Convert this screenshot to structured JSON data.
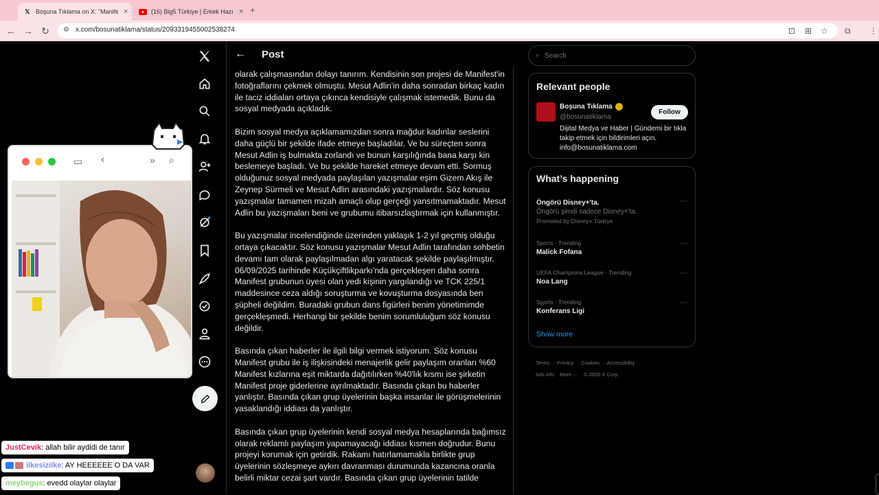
{
  "browser": {
    "tabs": [
      {
        "title": "Boşuna Tıklama on X: \"Manifest...",
        "favicon": "x-logo",
        "active": true
      },
      {
        "title": "(16) Big5 Türkiye | Erkek Hazırlık...",
        "favicon": "youtube-logo",
        "active": false
      }
    ],
    "new_tab": "+",
    "url": "x.com/bosunatiklama/status/2093319455002538274"
  },
  "nav": {
    "items": [
      "x-logo",
      "home-icon",
      "explore-icon",
      "notifications-icon",
      "follow-icon",
      "messages-icon",
      "grok-icon",
      "bookmarks-icon",
      "premium-icon",
      "verified-orgs-icon",
      "profile-icon",
      "more-icon"
    ],
    "compose": "compose-icon"
  },
  "post": {
    "header_title": "Post",
    "paragraphs": [
      "olarak çalışmasından dolayı tanırım. Kendisinin son projesi de Manifest'in fotoğraflarını çekmek olmuştu. Mesut Adlin'in daha sonradan birkaç kadın ile taciz iddiaları ortaya çıkınca kendisiyle çalışmak istemedik. Bunu da sosyal medyada açıkladık.",
      "Bizim sosyal medya açıklamamızdan sonra mağdur kadınlar seslerini daha güçlü bir şekilde ifade etmeye başladılar. Ve bu süreçten sonra Mesut Adlin iş bulmakta zorlandı ve bunun karşılığında bana karşı kin beslemeye başladı. Ve bu şekilde hareket etmeye devam etti. Sormuş olduğunuz sosyal medyada paylaşılan yazışmalar eşim Gizem Akış ile Zeynep Sürmeli ve Mesut Adlin arasındaki yazışmalardır. Söz konusu yazışmalar tamamen mizah amaçlı olup gerçeği yansıtmamaktadır. Mesut Adlin bu yazışmaları beni ve grubumu itibarsızlaştırmak için kullanmıştır.",
      "Bu yazışmalar incelendiğinde üzerinden yaklaşık 1-2 yıl geçmiş olduğu ortaya çıkacaktır. Söz konusu yazışmalar Mesut Adlin tarafından sohbetin devamı tam olarak paylaşılmadan algı yaratacak şekilde paylaşılmıştır. 06/09/2025 tarihinde Küçükçiftlikparkı'nda gerçekleşen daha sonra Manifest grubunun üyesi olan yedi kişinin yargılandığı ve TCK 225/1 maddesince ceza aldığı soruşturma ve kovuşturma dosyasında ben şüpheli değildim. Buradaki grubun dans figürleri benim yönetimimde gerçekleşmedi. Herhangi bir şekilde benim sorumluluğum söz konusu değildir.",
      "Basında çıkan haberler ile ilgili bilgi vermek istiyorum. Söz konusu Manifest grubu ile iş ilişkisindeki menajerlik gelir paylaşım oranları %60 Manifest kızlarına eşit miktarda dağıtılırken %40'lık kısmı ise şirketin Manifest proje giderlerine ayrılmaktadır. Basında çıkan bu haberler yanlıştır. Basında çıkan grup üyelerinin başka insanlar ile görüşmelerinin yasaklandığı iddiası da yanlıştır.",
      "Basında çıkan grup üyelerinin kendi sosyal medya hesaplarında bağımsız olarak reklamlı paylaşım yapamayacağı iddiası kısmen doğrudur. Bunu projeyi korumak için getirdik. Rakamı hatırlamamakla birlikte grup üyelerinin sözleşmeye aykırı davranması durumunda kazancına oranla belirli miktar cezai şart vardır. Basında çıkan grup üyelerinin tatilde"
    ]
  },
  "sidebar": {
    "search_placeholder": "Search",
    "relevant_people": {
      "title": "Relevant people",
      "name": "Boşuna Tıklama",
      "handle": "@bosunatiklama",
      "follow_label": "Follow",
      "bio": "Dijital Medya ve Haber | Gündemi bir tıkla takip etmek için bildirimleri açın. info@bosunatiklama.com"
    },
    "whats_happening": {
      "title": "What’s happening",
      "trends": [
        {
          "name": "Öngörü Disney+'ta.",
          "sub": "Öngörü şimdi sadece Disney+'ta.",
          "promo": "Promoted by Disney+ Türkiye"
        },
        {
          "context": "Sports · Trending",
          "name": "Malick Fofana"
        },
        {
          "context": "UEFA Champions League · Trending",
          "name": "Noa Lang"
        },
        {
          "context": "Sports · Trending",
          "name": "Konferans Ligi"
        }
      ],
      "show_more": "Show more"
    },
    "footer": [
      "Terms",
      "Privacy",
      "Cookies",
      "Accessibility",
      "Ads info",
      "More ···",
      "© 2026 X Corp."
    ]
  },
  "chat": [
    {
      "user": "JustCevik",
      "message": ": allah bilir aydidi de tanır",
      "color": "#e0245e"
    },
    {
      "user": "ilkesizilke",
      "message": ": AY HEEEEEE O DA VAR",
      "color": "#7b8cff"
    },
    {
      "user": "meybegus",
      "message": ": evedd olaylar olaylar",
      "color": "#8fd67a"
    }
  ],
  "colors": {
    "accent": "#1d9bf0",
    "tabbar": "#f6c8d0",
    "toolbar": "#fbe3e7"
  }
}
